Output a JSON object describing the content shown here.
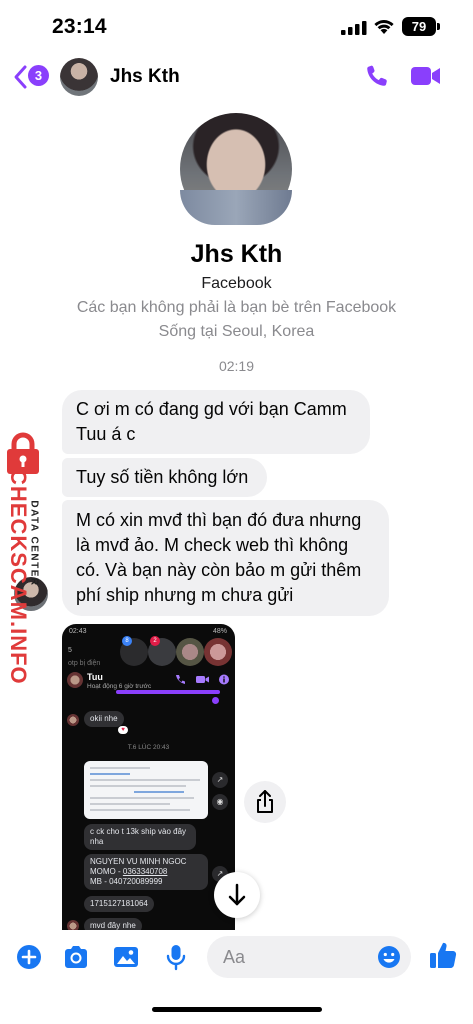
{
  "status_bar": {
    "time": "23:14",
    "battery": "79"
  },
  "header": {
    "back_count": "3",
    "contact_name": "Jhs Kth"
  },
  "profile": {
    "name": "Jhs Kth",
    "source": "Facebook",
    "relation": "Các bạn không phải là bạn bè trên Facebook",
    "location": "Sống tại Seoul, Korea"
  },
  "thread": {
    "time_divider": "02:19",
    "messages": [
      {
        "text": "C ơi m có đang gd với bạn Camm Tuu á c"
      },
      {
        "text": "Tuy số tiền không lớn"
      },
      {
        "text": "M có xin mvđ thì bạn đó đưa nhưng là mvđ ảo. M check web thì không có. Và bạn này còn bảo m gửi thêm phí ship nhưng m chưa gửi"
      }
    ]
  },
  "watermark": {
    "main": "CHECKSCAM.INFO",
    "sub": "DATA CENTER"
  },
  "attachment": {
    "status_time": "02:43",
    "status_battery": "48%",
    "prev_text": "otp bị điện",
    "contact_name": "Tuu",
    "activity": "Hoạt động 6 giờ trước",
    "messages": [
      {
        "text": "okii nhe"
      },
      {
        "text": "c ck cho t 13k ship vào đây nha"
      },
      {
        "line1": "NGUYEN VU MINH NGOC",
        "line2_prefix": "MOMO - ",
        "line2_link": "0363340708",
        "line3": "MB - 040720089999"
      },
      {
        "text": "1715127181064"
      },
      {
        "text": "mvd đây nhe"
      }
    ],
    "date_divider": "T.6 LÚC 20:43",
    "badge_1": "8",
    "badge_2": "2",
    "bubble_count": "5"
  },
  "composer": {
    "placeholder": "Aa"
  },
  "colors": {
    "accent": "#8a3ffc",
    "bubble": "#f0f0f2",
    "messenger_blue": "#1877f2",
    "watermark_red": "#e03a3a"
  }
}
